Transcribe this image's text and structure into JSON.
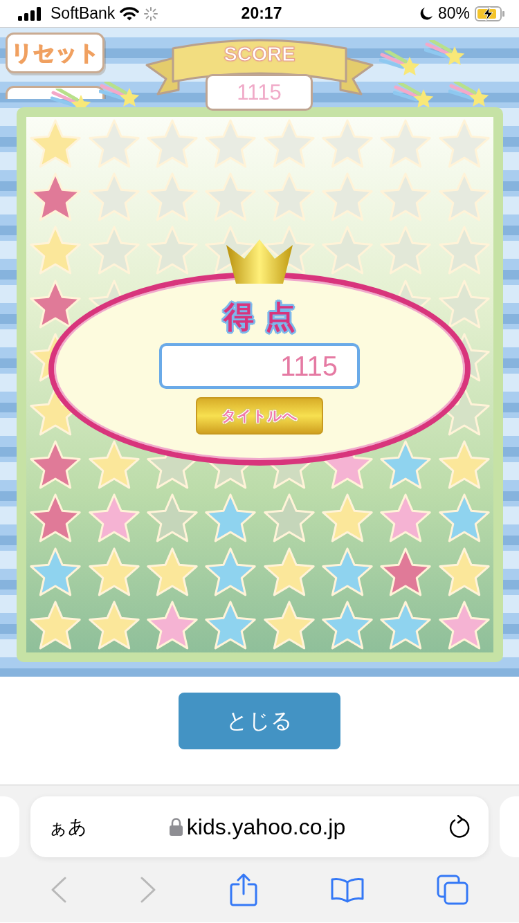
{
  "status_bar": {
    "carrier": "SoftBank",
    "time": "20:17",
    "battery": "80%"
  },
  "game": {
    "reset_button": "リセット",
    "score_label": "SCORE",
    "score": "1115",
    "board": {
      "rows": [
        {
          "cells": [
            {
              "color": "#fbe79a"
            },
            {
              "color": "#e9ece3"
            },
            {
              "color": "#e9ece3"
            },
            {
              "color": "#e9ece3"
            },
            {
              "color": "#e9ece3"
            },
            {
              "color": "#e9ece3"
            },
            {
              "color": "#e9ece3"
            },
            {
              "color": "#e9ece3"
            }
          ]
        },
        {
          "cells": [
            {
              "color": "#e07a98"
            },
            {
              "color": "#e6eadf"
            },
            {
              "color": "#e6eadf"
            },
            {
              "color": "#e6eadf"
            },
            {
              "color": "#e6eadf"
            },
            {
              "color": "#e6eadf"
            },
            {
              "color": "#e6eadf"
            },
            {
              "color": "#e6eadf"
            }
          ]
        },
        {
          "cells": [
            {
              "color": "#fbe79a"
            },
            {
              "color": "#e2e8d8"
            },
            {
              "color": "#e2e8d8"
            },
            {
              "color": "#e2e8d8"
            },
            {
              "color": "#e2e8d8"
            },
            {
              "color": "#e2e8d8"
            },
            {
              "color": "#e2e8d8"
            },
            {
              "color": "#e2e8d8"
            }
          ]
        },
        {
          "cells": [
            {
              "color": "#e07a98"
            },
            {
              "color": "#dee6d2"
            },
            null,
            null,
            null,
            null,
            {
              "color": "#dee6d2"
            },
            {
              "color": "#dee6d2"
            }
          ]
        },
        {
          "cells": [
            {
              "color": "#fbe79a"
            },
            null,
            null,
            null,
            null,
            null,
            null,
            {
              "color": "#d9e4cc"
            }
          ]
        },
        {
          "cells": [
            {
              "color": "#fbe79a"
            },
            null,
            null,
            null,
            null,
            null,
            null,
            {
              "color": "#d5e2c6"
            }
          ]
        },
        {
          "cells": [
            {
              "color": "#e07a98"
            },
            {
              "color": "#fbe79a"
            },
            {
              "color": "#cfdcc0"
            },
            {
              "color": "#cfdcc0"
            },
            {
              "color": "#cfdcc0"
            },
            {
              "color": "#f5b3d3"
            },
            {
              "color": "#8fd3ef"
            },
            {
              "color": "#fbe79a"
            }
          ]
        },
        {
          "cells": [
            {
              "color": "#e07a98"
            },
            {
              "color": "#f5b3d3"
            },
            {
              "color": "#c5d6ba"
            },
            {
              "color": "#8fd3ef"
            },
            {
              "color": "#c5d6ba"
            },
            {
              "color": "#fbe79a"
            },
            {
              "color": "#f5b3d3"
            },
            {
              "color": "#8fd3ef"
            }
          ]
        },
        {
          "cells": [
            {
              "color": "#8fd3ef"
            },
            {
              "color": "#fbe79a"
            },
            {
              "color": "#fbe79a"
            },
            {
              "color": "#8fd3ef"
            },
            {
              "color": "#fbe79a"
            },
            {
              "color": "#8fd3ef"
            },
            {
              "color": "#e07a98"
            },
            {
              "color": "#fbe79a"
            }
          ]
        },
        {
          "cells": [
            {
              "color": "#fbe79a"
            },
            {
              "color": "#fbe79a"
            },
            {
              "color": "#f5b3d3"
            },
            {
              "color": "#8fd3ef"
            },
            {
              "color": "#fbe79a"
            },
            {
              "color": "#8fd3ef"
            },
            {
              "color": "#8fd3ef"
            },
            {
              "color": "#f5b3d3"
            }
          ]
        }
      ]
    },
    "result": {
      "title": "得 点",
      "score": "1115",
      "title_button": "タイトルへ"
    }
  },
  "close_button": "とじる",
  "browser": {
    "text_size_button": "ぁあ",
    "url": "kids.yahoo.co.jp",
    "back_disabled": true,
    "forward_disabled": true
  }
}
